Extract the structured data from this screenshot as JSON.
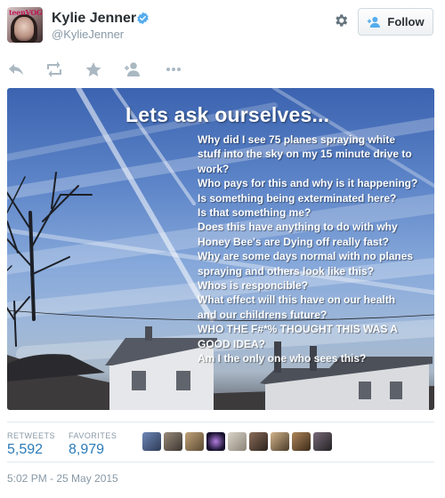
{
  "user": {
    "name": "Kylie Jenner",
    "handle": "@KylieJenner",
    "avatar_text": "teenVOGUE",
    "verified_color": "#55acee"
  },
  "header": {
    "follow_label": "Follow"
  },
  "actions": [
    "reply-icon",
    "retweet-icon",
    "favorite-icon",
    "follow-icon",
    "more-icon"
  ],
  "image": {
    "title": "Lets ask ourselves...",
    "lines": [
      "Why did I see 75 planes spraying white",
      "stuff into the sky on my 15 minute drive to",
      "work?",
      "Who pays for this and why is it happening?",
      "Is something being exterminated here?",
      "Is that something me?",
      "Does this have anything to do with why",
      "Honey Bee's are Dying off really fast?",
      "Why are some days normal with no planes",
      "spraying and others look like this?",
      "Whos is responcible?",
      "What effect will this have on our health",
      "and our childrens future?",
      "WHO THE F#*% THOUGHT THIS WAS A",
      "GOOD IDEA?",
      "Am I the only one who sees this?"
    ]
  },
  "stats": {
    "retweets_label": "RETWEETS",
    "retweets": "5,592",
    "favorites_label": "FAVORITES",
    "favorites": "8,979",
    "link_color": "#2b7bb9"
  },
  "timestamp": "5:02 PM - 25 May 2015"
}
